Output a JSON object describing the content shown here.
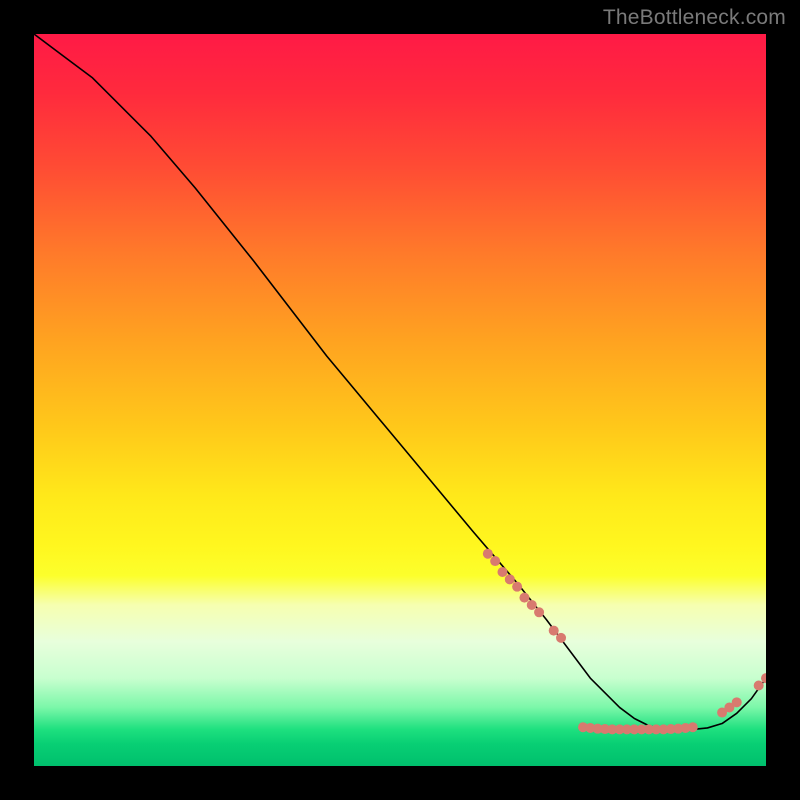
{
  "watermark": "TheBottleneck.com",
  "chart_data": {
    "type": "line",
    "title": "",
    "xlabel": "",
    "ylabel": "",
    "xlim": [
      0,
      100
    ],
    "ylim": [
      0,
      100
    ],
    "series": [
      {
        "name": "curve",
        "x": [
          0,
          4,
          8,
          12,
          16,
          22,
          30,
          40,
          50,
          60,
          66,
          70,
          73,
          76,
          78,
          80,
          82,
          84,
          86,
          88,
          90,
          92,
          94,
          96,
          98,
          100
        ],
        "y": [
          100,
          97,
          94,
          90,
          86,
          79,
          69,
          56,
          44,
          32,
          25,
          20,
          16,
          12,
          10,
          8,
          6.5,
          5.5,
          5,
          5,
          5,
          5.2,
          5.8,
          7.2,
          9.2,
          12
        ],
        "stroke": "#000000",
        "stroke_width": 1.6
      }
    ],
    "markers": {
      "name": "highlight-dots",
      "color": "#d87a6f",
      "radius": 5,
      "points": [
        {
          "x": 62,
          "y": 29
        },
        {
          "x": 63,
          "y": 28
        },
        {
          "x": 64,
          "y": 26.5
        },
        {
          "x": 65,
          "y": 25.5
        },
        {
          "x": 66,
          "y": 24.5
        },
        {
          "x": 67,
          "y": 23
        },
        {
          "x": 68,
          "y": 22
        },
        {
          "x": 69,
          "y": 21
        },
        {
          "x": 71,
          "y": 18.5
        },
        {
          "x": 72,
          "y": 17.5
        },
        {
          "x": 75,
          "y": 5.3
        },
        {
          "x": 76,
          "y": 5.2
        },
        {
          "x": 77,
          "y": 5.1
        },
        {
          "x": 78,
          "y": 5.05
        },
        {
          "x": 79,
          "y": 5.0
        },
        {
          "x": 80,
          "y": 5.0
        },
        {
          "x": 81,
          "y": 5.0
        },
        {
          "x": 82,
          "y": 5.0
        },
        {
          "x": 83,
          "y": 5.0
        },
        {
          "x": 84,
          "y": 5.0
        },
        {
          "x": 85,
          "y": 5.0
        },
        {
          "x": 86,
          "y": 5.0
        },
        {
          "x": 87,
          "y": 5.05
        },
        {
          "x": 88,
          "y": 5.1
        },
        {
          "x": 89,
          "y": 5.2
        },
        {
          "x": 90,
          "y": 5.3
        },
        {
          "x": 94,
          "y": 7.3
        },
        {
          "x": 95,
          "y": 8.0
        },
        {
          "x": 96,
          "y": 8.7
        },
        {
          "x": 99,
          "y": 11.0
        },
        {
          "x": 100,
          "y": 12.0
        }
      ]
    },
    "background": {
      "type": "vertical-gradient",
      "stops": [
        {
          "pos": 0.0,
          "color": "#ff1a46"
        },
        {
          "pos": 0.2,
          "color": "#ff5a30"
        },
        {
          "pos": 0.42,
          "color": "#ffa320"
        },
        {
          "pos": 0.63,
          "color": "#ffe81a"
        },
        {
          "pos": 0.78,
          "color": "#f6ffb0"
        },
        {
          "pos": 0.9,
          "color": "#8af7af"
        },
        {
          "pos": 1.0,
          "color": "#00c06d"
        }
      ]
    }
  }
}
